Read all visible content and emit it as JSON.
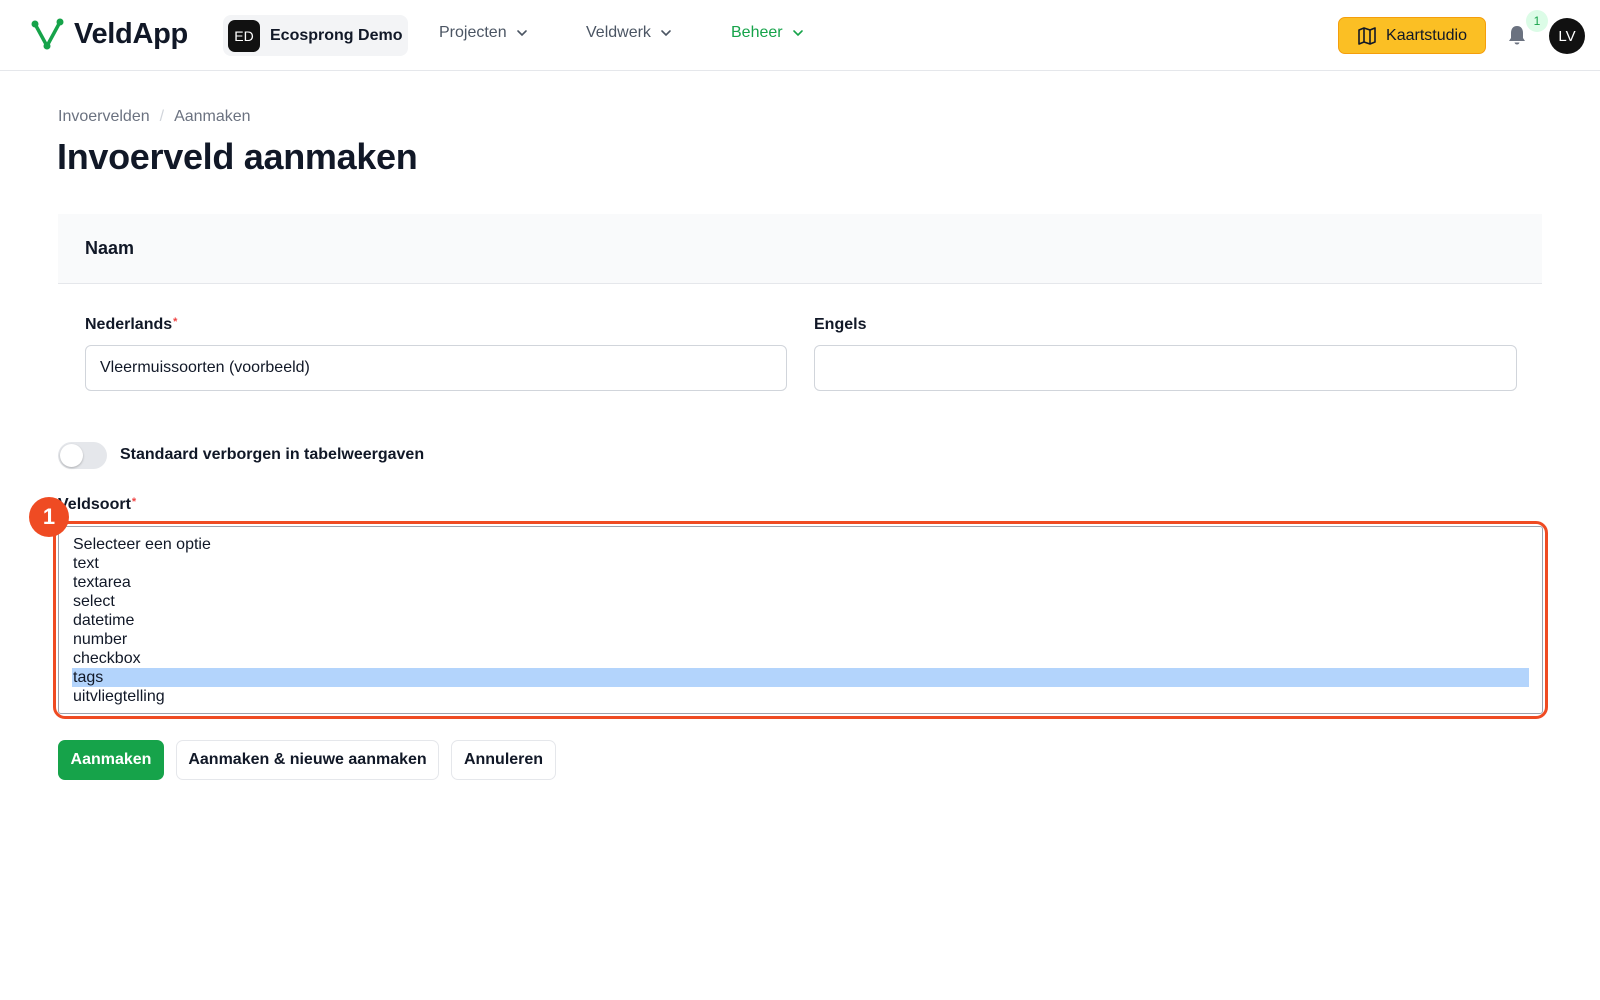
{
  "header": {
    "app_name": "VeldApp",
    "tenant": {
      "initials": "ED",
      "name": "Ecosprong Demo"
    },
    "nav": [
      {
        "label": "Projecten",
        "active": false
      },
      {
        "label": "Veldwerk",
        "active": false
      },
      {
        "label": "Beheer",
        "active": true
      }
    ],
    "map_button_label": "Kaartstudio",
    "notification_count": "1",
    "user_initials": "LV"
  },
  "breadcrumb": {
    "items": [
      "Invoervelden",
      "Aanmaken"
    ],
    "separator": "/"
  },
  "page_title": "Invoerveld aanmaken",
  "name_section": {
    "title": "Naam",
    "dutch": {
      "label": "Nederlands",
      "required_mark": "*",
      "value": "Vleermuissoorten (voorbeeld)"
    },
    "english": {
      "label": "Engels",
      "value": ""
    }
  },
  "hidden_toggle": {
    "label": "Standaard verborgen in tabelweergaven",
    "checked": false
  },
  "field_type": {
    "label": "Veldsoort",
    "required_mark": "*",
    "options": [
      "Selecteer een optie",
      "text",
      "textarea",
      "select",
      "datetime",
      "number",
      "checkbox",
      "tags",
      "uitvliegtelling"
    ],
    "selected": "tags"
  },
  "annotation": {
    "marker": "1"
  },
  "actions": {
    "create": "Aanmaken",
    "create_another": "Aanmaken & nieuwe aanmaken",
    "cancel": "Annuleren"
  },
  "colors": {
    "brand_green": "#16a34a",
    "map_button": "#fbbf24",
    "annotation_red": "#ef4b23",
    "selection": "#b3d4fc"
  }
}
